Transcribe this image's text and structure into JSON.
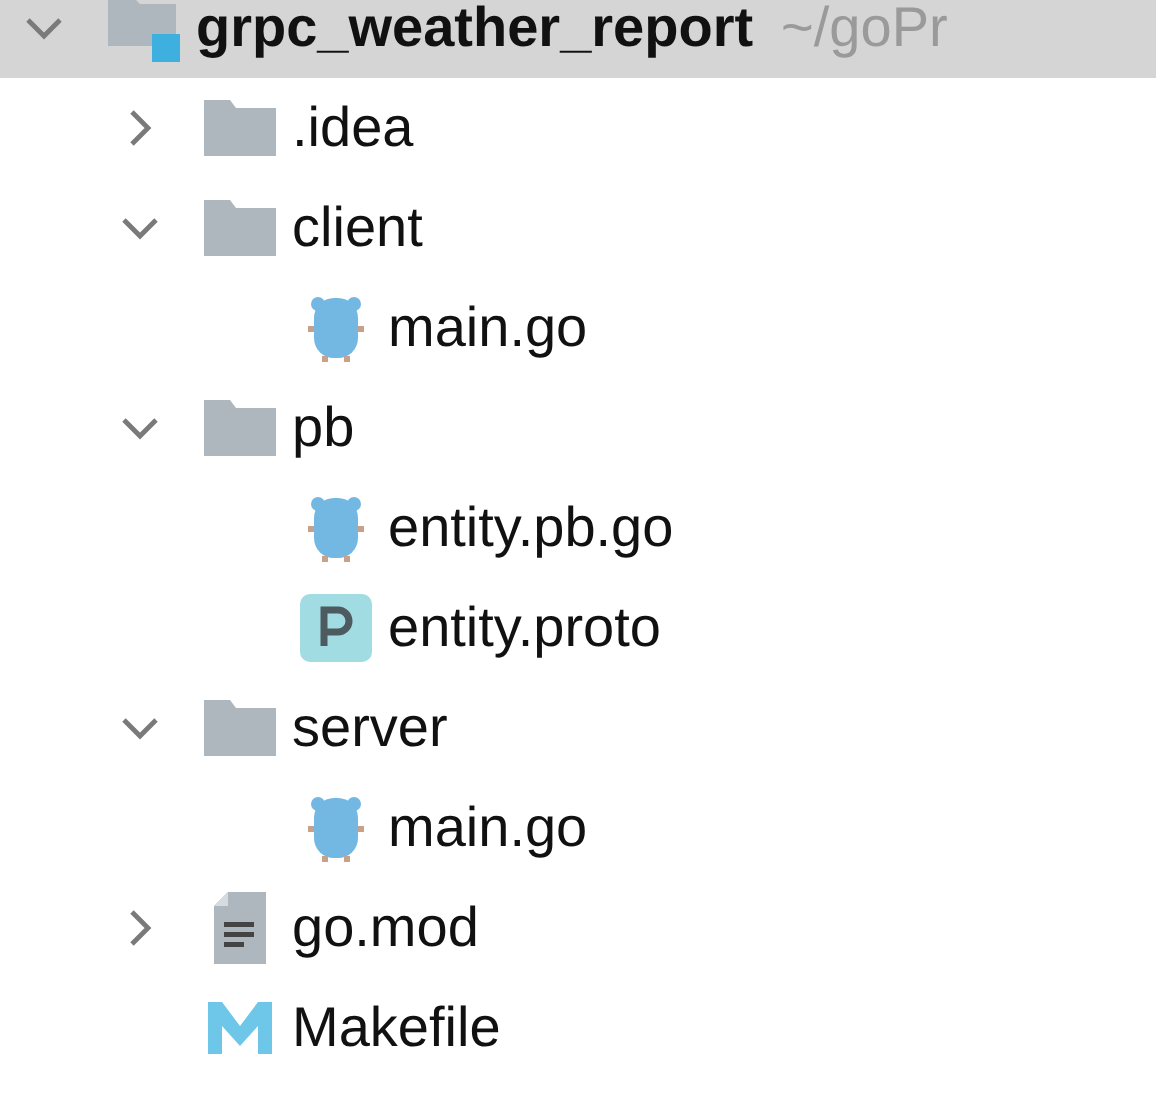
{
  "project_tree": [
    {
      "name": "grpc_weather_report",
      "path": "~/goPr",
      "kind": "module",
      "expanded": true,
      "selected": true,
      "children": [
        {
          "name": ".idea",
          "kind": "folder",
          "expanded": false,
          "selected": false
        },
        {
          "name": "client",
          "kind": "folder",
          "expanded": true,
          "selected": false,
          "children": [
            {
              "name": "main.go",
              "kind": "go",
              "selected": false
            }
          ]
        },
        {
          "name": "pb",
          "kind": "folder",
          "expanded": true,
          "selected": false,
          "children": [
            {
              "name": "entity.pb.go",
              "kind": "go",
              "selected": false
            },
            {
              "name": "entity.proto",
              "kind": "proto",
              "selected": false
            }
          ]
        },
        {
          "name": "server",
          "kind": "folder",
          "expanded": true,
          "selected": false,
          "children": [
            {
              "name": "main.go",
              "kind": "go",
              "selected": false
            }
          ]
        },
        {
          "name": "go.mod",
          "kind": "text",
          "expanded": false,
          "selected": false
        },
        {
          "name": "Makefile",
          "kind": "makefile",
          "selected": false
        }
      ]
    }
  ]
}
